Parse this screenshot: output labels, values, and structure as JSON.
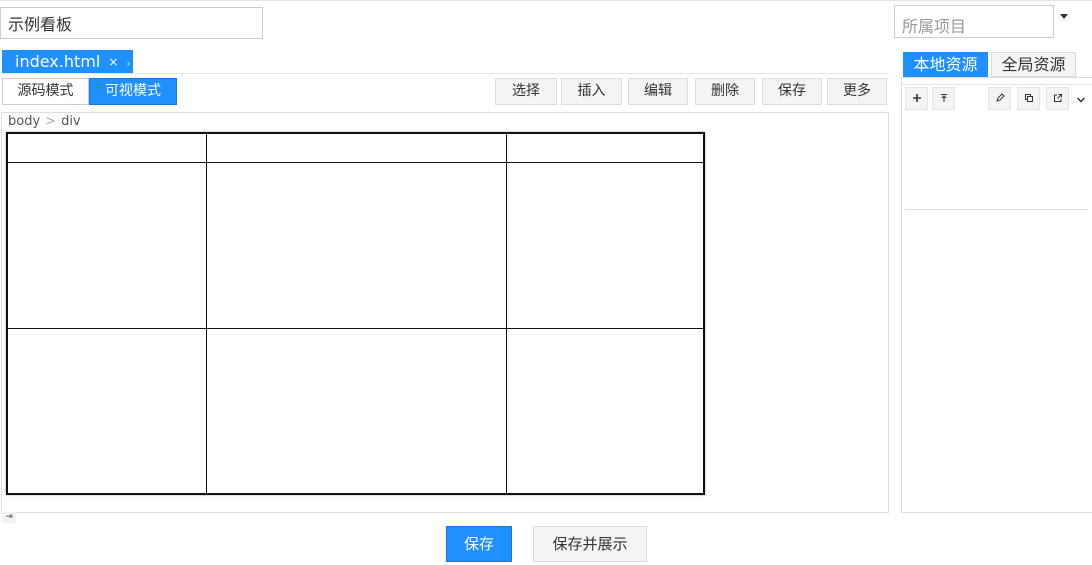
{
  "header": {
    "title_value": "示例看板",
    "project_placeholder": "所属项目"
  },
  "file_tabs": [
    {
      "label": "index.html",
      "close": "×",
      "arrow": "›"
    }
  ],
  "modes": {
    "source_label": "源码模式",
    "visual_label": "可视模式",
    "active": "visual"
  },
  "toolbar": {
    "select_label": "选择",
    "insert_label": "插入",
    "edit_label": "编辑",
    "delete_label": "删除",
    "save_label": "保存",
    "more_label": "更多"
  },
  "breadcrumb": {
    "items": [
      "body",
      "div"
    ],
    "separator": ">"
  },
  "table": {
    "rows": 3,
    "cols": 3
  },
  "footer": {
    "save_label": "保存",
    "save_show_label": "保存并展示"
  },
  "resources": {
    "tab_local": "本地资源",
    "tab_global": "全局资源",
    "active_tab": "local",
    "tools": [
      "plus-icon",
      "upload-icon",
      "pencil-icon",
      "copy-icon",
      "external-link-icon",
      "chevron-down-icon"
    ]
  },
  "colors": {
    "accent": "#1e90ff",
    "border": "#dddddd",
    "button_bg": "#f4f4f4"
  }
}
